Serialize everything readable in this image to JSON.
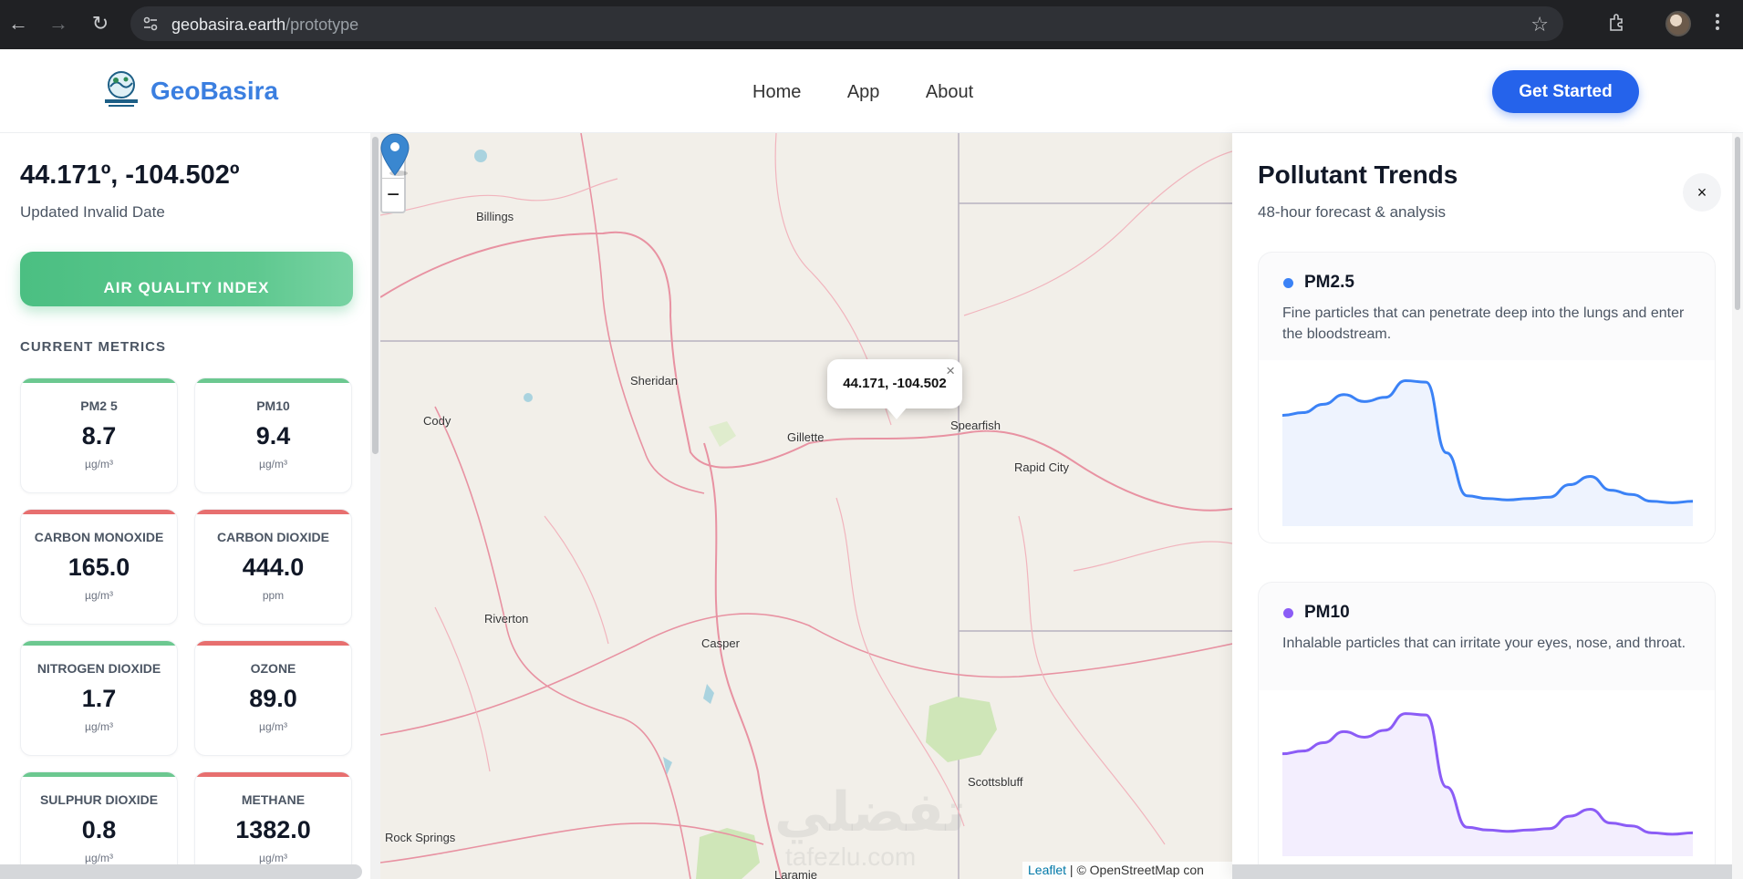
{
  "browser": {
    "url_domain": "geobasira.earth",
    "url_path": "/prototype"
  },
  "header": {
    "brand": "GeoBasira",
    "nav": [
      "Home",
      "App",
      "About"
    ],
    "cta_label": "Get Started"
  },
  "location": {
    "coords": "44.171º, -104.502º",
    "updated": "Updated Invalid Date",
    "aqi_label": "AIR QUALITY INDEX"
  },
  "metrics_section_label": "CURRENT METRICS",
  "metrics": [
    {
      "name": "PM2 5",
      "value": "8.7",
      "unit": "µg/m³",
      "status_color": "#6cc890"
    },
    {
      "name": "PM10",
      "value": "9.4",
      "unit": "µg/m³",
      "status_color": "#6cc890"
    },
    {
      "name": "CARBON MONOXIDE",
      "value": "165.0",
      "unit": "µg/m³",
      "status_color": "#e76f6f"
    },
    {
      "name": "CARBON DIOXIDE",
      "value": "444.0",
      "unit": "ppm",
      "status_color": "#e76f6f"
    },
    {
      "name": "NITROGEN DIOXIDE",
      "value": "1.7",
      "unit": "µg/m³",
      "status_color": "#6cc890"
    },
    {
      "name": "OZONE",
      "value": "89.0",
      "unit": "µg/m³",
      "status_color": "#e76f6f"
    },
    {
      "name": "SULPHUR DIOXIDE",
      "value": "0.8",
      "unit": "µg/m³",
      "status_color": "#6cc890"
    },
    {
      "name": "METHANE",
      "value": "1382.0",
      "unit": "µg/m³",
      "status_color": "#e76f6f"
    }
  ],
  "map": {
    "popup": "44.171, -104.502",
    "labels": [
      {
        "text": "Billings"
      },
      {
        "text": "Sheridan"
      },
      {
        "text": "Cody"
      },
      {
        "text": "Gillette"
      },
      {
        "text": "Spearfish"
      },
      {
        "text": "Rapid City"
      },
      {
        "text": "Riverton"
      },
      {
        "text": "Casper"
      },
      {
        "text": "Scottsbluff"
      },
      {
        "text": "Rock Springs"
      },
      {
        "text": "Laramie"
      }
    ],
    "zoom_in": "+",
    "zoom_out": "−",
    "attribution_leaflet": "Leaflet",
    "attribution_rest": " | © OpenStreetMap con",
    "watermark": "تفضلي",
    "watermark_sub": "tafezlu.com"
  },
  "trends_panel": {
    "title": "Pollutant Trends",
    "subtitle": "48-hour forecast & analysis",
    "close": "×",
    "cards": [
      {
        "name": "PM2.5",
        "color": "#3b82f6",
        "fill": "#eef3fe",
        "description": "Fine particles that can penetrate deep into the lungs and enter the bloodstream.",
        "values": [
          0.72,
          0.74,
          0.8,
          0.87,
          0.82,
          0.85,
          0.97,
          0.96,
          0.45,
          0.14,
          0.12,
          0.11,
          0.12,
          0.13,
          0.22,
          0.28,
          0.18,
          0.15,
          0.1,
          0.09,
          0.1
        ]
      },
      {
        "name": "PM10",
        "color": "#8b5cf6",
        "fill": "#f3eefe",
        "description": "Inhalable particles that can irritate your eyes, nose, and throat.",
        "values": [
          0.66,
          0.68,
          0.74,
          0.82,
          0.78,
          0.83,
          0.95,
          0.94,
          0.42,
          0.13,
          0.11,
          0.1,
          0.11,
          0.12,
          0.21,
          0.26,
          0.16,
          0.14,
          0.09,
          0.08,
          0.09
        ]
      }
    ]
  }
}
